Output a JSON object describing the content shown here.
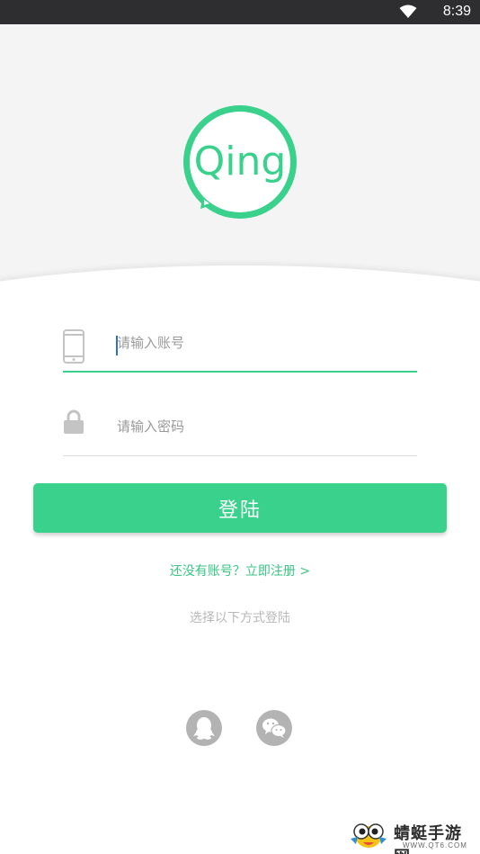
{
  "status_bar": {
    "time": "8:39"
  },
  "logo": {
    "text": "Qing",
    "brand_color": "#39d18b"
  },
  "account_field": {
    "placeholder": "请输入账号",
    "value": ""
  },
  "password_field": {
    "placeholder": "请输入密码",
    "value": ""
  },
  "login_button": {
    "label": "登陆"
  },
  "register_link": {
    "label": "还没有账号？立即注册 >"
  },
  "alt_login": {
    "label": "选择以下方式登陆",
    "options": [
      "qq-icon",
      "wechat-icon"
    ]
  },
  "watermark": {
    "name": "蜻蜓手游网",
    "url": "WWW.QT6.COM"
  },
  "colors": {
    "accent": "#39d18b",
    "status_bar": "#2e2e30",
    "muted": "#b8b8b8"
  }
}
